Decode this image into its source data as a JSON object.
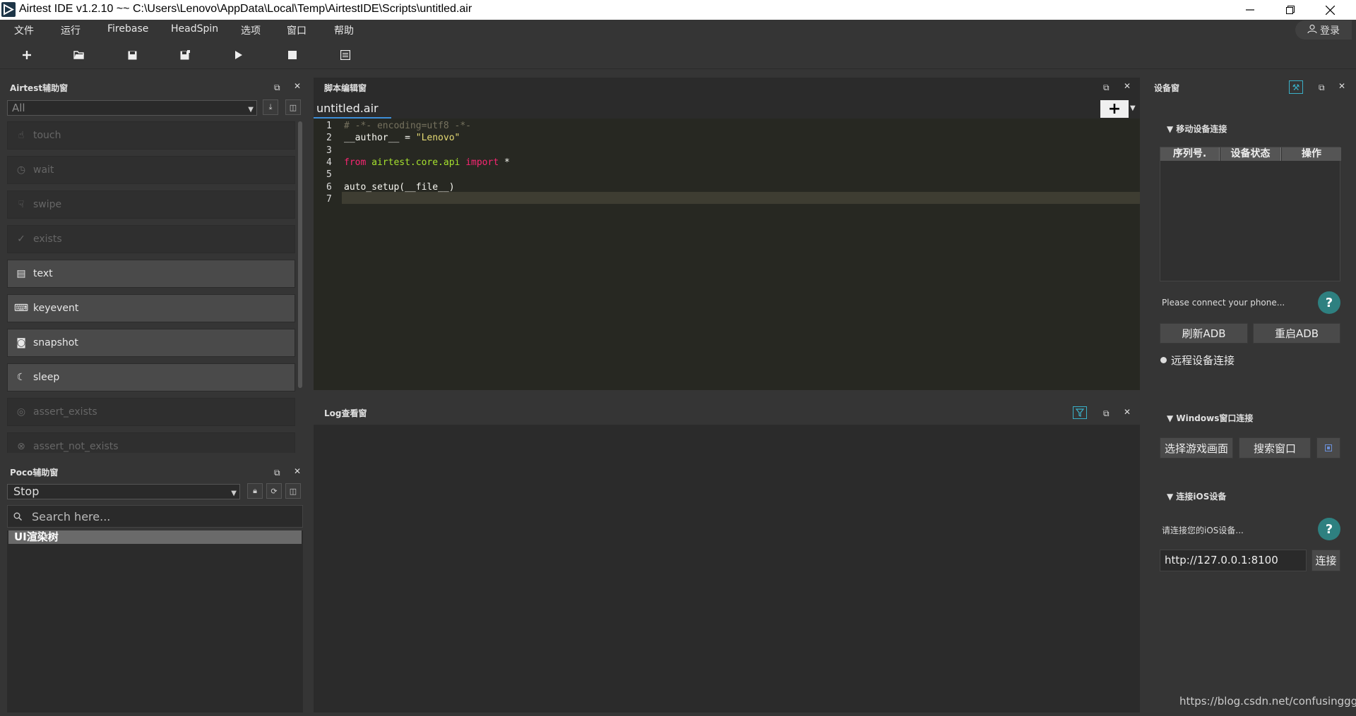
{
  "window": {
    "title": "Airtest IDE v1.2.10 ~~ C:\\Users\\Lenovo\\AppData\\Local\\Temp\\AirtestIDE\\Scripts\\untitled.air",
    "minimize_icon": "minimize-icon",
    "maximize_icon": "restore-icon",
    "close_icon": "close-icon"
  },
  "menu": {
    "items": [
      "文件",
      "运行",
      "Firebase",
      "HeadSpin",
      "选项",
      "窗口",
      "帮助"
    ],
    "login_label": "登录"
  },
  "toolbar": {
    "icons": [
      "new-file-icon",
      "open-folder-icon",
      "save-icon",
      "save-as-icon",
      "run-icon",
      "stop-icon",
      "log-view-icon"
    ]
  },
  "airtest_panel": {
    "title": "Airtest辅助窗",
    "filter_value": "All",
    "items": [
      {
        "label": "touch",
        "icon": "hand-tap-icon",
        "enabled": false
      },
      {
        "label": "wait",
        "icon": "clock-icon",
        "enabled": false
      },
      {
        "label": "swipe",
        "icon": "swipe-icon",
        "enabled": false
      },
      {
        "label": "exists",
        "icon": "check-circle-icon",
        "enabled": false
      },
      {
        "label": "text",
        "icon": "text-box-icon",
        "enabled": true
      },
      {
        "label": "keyevent",
        "icon": "keyboard-icon",
        "enabled": true
      },
      {
        "label": "snapshot",
        "icon": "camera-icon",
        "enabled": true
      },
      {
        "label": "sleep",
        "icon": "moon-icon",
        "enabled": true
      },
      {
        "label": "assert_exists",
        "icon": "target-icon",
        "enabled": false
      },
      {
        "label": "assert_not_exists",
        "icon": "target-x-icon",
        "enabled": false
      }
    ]
  },
  "poco_panel": {
    "title": "Poco辅助窗",
    "mode_value": "Stop",
    "search_placeholder": "Search here...",
    "tree_root": "UI渲染树"
  },
  "editor": {
    "title": "脚本编辑窗",
    "tab_label": "untitled.air",
    "tab_close": "✕",
    "add_tab": "+",
    "code_lines": [
      {
        "n": "1",
        "text": "# -*- encoding=utf8 -*-"
      },
      {
        "n": "2",
        "text": "__author__ = \"Lenovo\""
      },
      {
        "n": "3",
        "text": ""
      },
      {
        "n": "4",
        "text": "from airtest.core.api import *"
      },
      {
        "n": "5",
        "text": ""
      },
      {
        "n": "6",
        "text": "auto_setup(__file__)"
      },
      {
        "n": "7",
        "text": ""
      }
    ]
  },
  "log": {
    "title": "Log查看窗"
  },
  "device": {
    "title": "设备窗",
    "mobile_section": "移动设备连接",
    "columns": [
      "序列号.",
      "设备状态",
      "操作"
    ],
    "connect_hint": "Please connect your phone...",
    "refresh_adb": "刷新ADB",
    "restart_adb": "重启ADB",
    "remote_connect": "远程设备连接",
    "windows_section": "Windows窗口连接",
    "select_game": "选择游戏画面",
    "search_window": "搜索窗口",
    "ios_section": "连接iOS设备",
    "ios_hint": "请连接您的iOS设备...",
    "ios_url": "http://127.0.0.1:8100",
    "connect": "连接"
  },
  "watermark": "https://blog.csdn.net/confusinggg"
}
